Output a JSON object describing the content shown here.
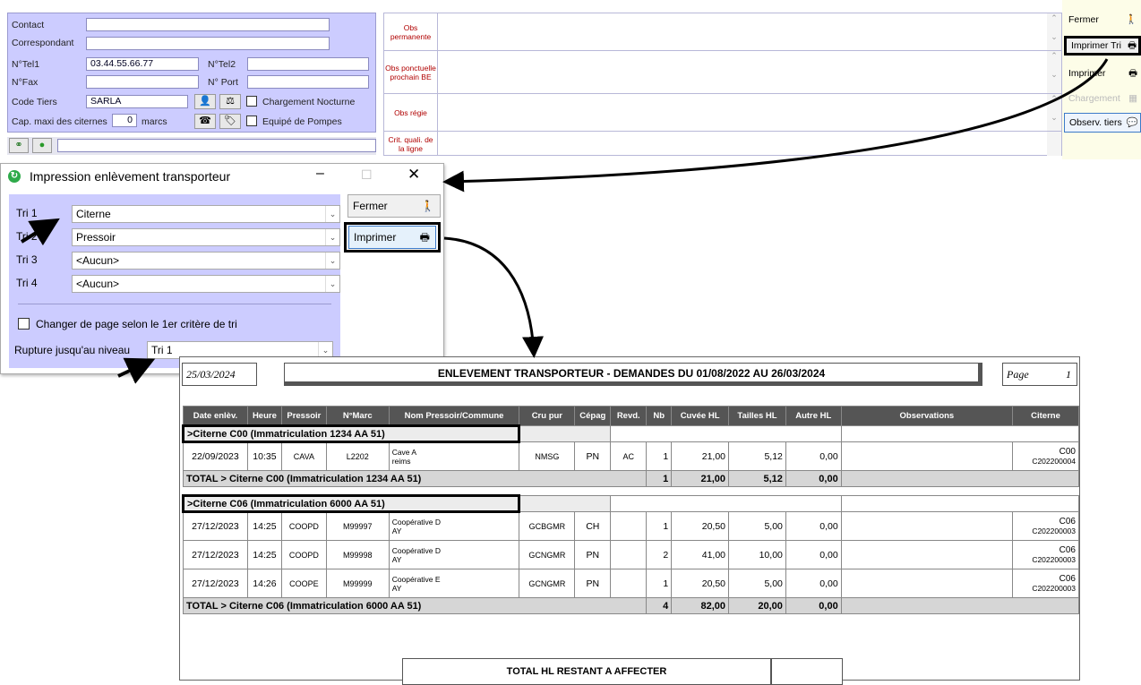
{
  "tiers": {
    "contact_label": "Contact",
    "correspondant_label": "Correspondant",
    "tel1_label": "N°Tel1",
    "tel1_value": "03.44.55.66.77",
    "tel2_label": "N°Tel2",
    "fax_label": "N°Fax",
    "port_label": "N° Port",
    "code_label": "Code Tiers",
    "code_value": "SARLA",
    "chargement_nocturne": "Chargement Nocturne",
    "cap_label": "Cap. maxi des citernes",
    "cap_value": "0",
    "cap_unit": "marcs",
    "equipe_pompes": "Equipé de Pompes"
  },
  "obs": {
    "permanente": "Obs permanente",
    "ponctuelle": "Obs ponctuelle prochain BE",
    "regie": "Obs régie",
    "crit": "Crit. quali. de la ligne"
  },
  "right_buttons": {
    "fermer": "Fermer",
    "imprimer_tri": "Imprimer Tri",
    "imprimer": "Imprimer",
    "chargement": "Chargement",
    "observ": "Observ. tiers"
  },
  "dialog": {
    "title": "Impression enlèvement transporteur",
    "tri1_label": "Tri 1",
    "tri1": "Citerne",
    "tri2_label": "Tri 2",
    "tri2": "Pressoir",
    "tri3_label": "Tri 3",
    "tri3": "<Aucun>",
    "tri4_label": "Tri 4",
    "tri4": "<Aucun>",
    "changer_page": "Changer de page selon le 1er critère de tri",
    "rupture_label": "Rupture jusqu'au niveau",
    "rupture": "Tri 1",
    "fermer": "Fermer",
    "imprimer": "Imprimer"
  },
  "report": {
    "date": "25/03/2024",
    "title": "ENLEVEMENT TRANSPORTEUR - DEMANDES DU 01/08/2022 AU 26/03/2024",
    "page_label": "Page",
    "page_num": "1",
    "headers": [
      "Date enlèv.",
      "Heure",
      "Pressoir",
      "N°Marc",
      "Nom Pressoir/Commune",
      "Cru pur",
      "Cépag",
      "Revd.",
      "Nb",
      "Cuvée HL",
      "Tailles HL",
      "Autre HL",
      "Observations",
      "Citerne"
    ],
    "groups": [
      {
        "title": ">Citerne C00 (Immatriculation 1234 AA 51)",
        "rows": [
          {
            "date": "22/09/2023",
            "heure": "10:35",
            "pressoir": "CAVA",
            "marc": "L2202",
            "nom": "Cave A",
            "commune": "reims",
            "cru": "NMSG",
            "cepage": "PN",
            "revd": "AC",
            "nb": "1",
            "cuvee": "21,00",
            "tailles": "5,12",
            "autre": "0,00",
            "obs": "",
            "citerne": "C00",
            "citerne_code": "C202200004"
          }
        ],
        "total_label": "TOTAL > Citerne C00 (Immatriculation 1234 AA 51)",
        "total_nb": "1",
        "total_cuvee": "21,00",
        "total_tailles": "5,12",
        "total_autre": "0,00"
      },
      {
        "title": ">Citerne C06 (Immatriculation 6000 AA 51)",
        "rows": [
          {
            "date": "27/12/2023",
            "heure": "14:25",
            "pressoir": "COOPD",
            "marc": "M99997",
            "nom": "Coopérative D",
            "commune": "AY",
            "cru": "GCBGMR",
            "cepage": "CH",
            "revd": "",
            "nb": "1",
            "cuvee": "20,50",
            "tailles": "5,00",
            "autre": "0,00",
            "obs": "",
            "citerne": "C06",
            "citerne_code": "C202200003"
          },
          {
            "date": "27/12/2023",
            "heure": "14:25",
            "pressoir": "COOPD",
            "marc": "M99998",
            "nom": "Coopérative D",
            "commune": "AY",
            "cru": "GCNGMR",
            "cepage": "PN",
            "revd": "",
            "nb": "2",
            "cuvee": "41,00",
            "tailles": "10,00",
            "autre": "0,00",
            "obs": "",
            "citerne": "C06",
            "citerne_code": "C202200003"
          },
          {
            "date": "27/12/2023",
            "heure": "14:26",
            "pressoir": "COOPE",
            "marc": "M99999",
            "nom": "Coopérative E",
            "commune": "AY",
            "cru": "GCNGMR",
            "cepage": "PN",
            "revd": "",
            "nb": "1",
            "cuvee": "20,50",
            "tailles": "5,00",
            "autre": "0,00",
            "obs": "",
            "citerne": "C06",
            "citerne_code": "C202200003"
          }
        ],
        "total_label": "TOTAL > Citerne C06 (Immatriculation 6000 AA 51)",
        "total_nb": "4",
        "total_cuvee": "82,00",
        "total_tailles": "20,00",
        "total_autre": "0,00"
      }
    ],
    "footer_total": "TOTAL HL RESTANT A AFFECTER"
  }
}
